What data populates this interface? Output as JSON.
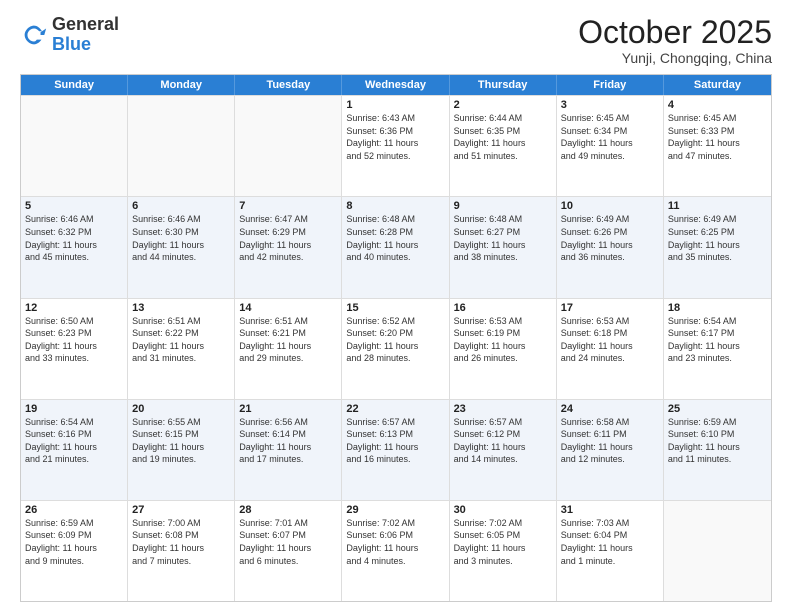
{
  "header": {
    "logo_general": "General",
    "logo_blue": "Blue",
    "month": "October 2025",
    "location": "Yunji, Chongqing, China"
  },
  "weekdays": [
    "Sunday",
    "Monday",
    "Tuesday",
    "Wednesday",
    "Thursday",
    "Friday",
    "Saturday"
  ],
  "rows": [
    [
      {
        "day": "",
        "text": ""
      },
      {
        "day": "",
        "text": ""
      },
      {
        "day": "",
        "text": ""
      },
      {
        "day": "1",
        "text": "Sunrise: 6:43 AM\nSunset: 6:36 PM\nDaylight: 11 hours\nand 52 minutes."
      },
      {
        "day": "2",
        "text": "Sunrise: 6:44 AM\nSunset: 6:35 PM\nDaylight: 11 hours\nand 51 minutes."
      },
      {
        "day": "3",
        "text": "Sunrise: 6:45 AM\nSunset: 6:34 PM\nDaylight: 11 hours\nand 49 minutes."
      },
      {
        "day": "4",
        "text": "Sunrise: 6:45 AM\nSunset: 6:33 PM\nDaylight: 11 hours\nand 47 minutes."
      }
    ],
    [
      {
        "day": "5",
        "text": "Sunrise: 6:46 AM\nSunset: 6:32 PM\nDaylight: 11 hours\nand 45 minutes."
      },
      {
        "day": "6",
        "text": "Sunrise: 6:46 AM\nSunset: 6:30 PM\nDaylight: 11 hours\nand 44 minutes."
      },
      {
        "day": "7",
        "text": "Sunrise: 6:47 AM\nSunset: 6:29 PM\nDaylight: 11 hours\nand 42 minutes."
      },
      {
        "day": "8",
        "text": "Sunrise: 6:48 AM\nSunset: 6:28 PM\nDaylight: 11 hours\nand 40 minutes."
      },
      {
        "day": "9",
        "text": "Sunrise: 6:48 AM\nSunset: 6:27 PM\nDaylight: 11 hours\nand 38 minutes."
      },
      {
        "day": "10",
        "text": "Sunrise: 6:49 AM\nSunset: 6:26 PM\nDaylight: 11 hours\nand 36 minutes."
      },
      {
        "day": "11",
        "text": "Sunrise: 6:49 AM\nSunset: 6:25 PM\nDaylight: 11 hours\nand 35 minutes."
      }
    ],
    [
      {
        "day": "12",
        "text": "Sunrise: 6:50 AM\nSunset: 6:23 PM\nDaylight: 11 hours\nand 33 minutes."
      },
      {
        "day": "13",
        "text": "Sunrise: 6:51 AM\nSunset: 6:22 PM\nDaylight: 11 hours\nand 31 minutes."
      },
      {
        "day": "14",
        "text": "Sunrise: 6:51 AM\nSunset: 6:21 PM\nDaylight: 11 hours\nand 29 minutes."
      },
      {
        "day": "15",
        "text": "Sunrise: 6:52 AM\nSunset: 6:20 PM\nDaylight: 11 hours\nand 28 minutes."
      },
      {
        "day": "16",
        "text": "Sunrise: 6:53 AM\nSunset: 6:19 PM\nDaylight: 11 hours\nand 26 minutes."
      },
      {
        "day": "17",
        "text": "Sunrise: 6:53 AM\nSunset: 6:18 PM\nDaylight: 11 hours\nand 24 minutes."
      },
      {
        "day": "18",
        "text": "Sunrise: 6:54 AM\nSunset: 6:17 PM\nDaylight: 11 hours\nand 23 minutes."
      }
    ],
    [
      {
        "day": "19",
        "text": "Sunrise: 6:54 AM\nSunset: 6:16 PM\nDaylight: 11 hours\nand 21 minutes."
      },
      {
        "day": "20",
        "text": "Sunrise: 6:55 AM\nSunset: 6:15 PM\nDaylight: 11 hours\nand 19 minutes."
      },
      {
        "day": "21",
        "text": "Sunrise: 6:56 AM\nSunset: 6:14 PM\nDaylight: 11 hours\nand 17 minutes."
      },
      {
        "day": "22",
        "text": "Sunrise: 6:57 AM\nSunset: 6:13 PM\nDaylight: 11 hours\nand 16 minutes."
      },
      {
        "day": "23",
        "text": "Sunrise: 6:57 AM\nSunset: 6:12 PM\nDaylight: 11 hours\nand 14 minutes."
      },
      {
        "day": "24",
        "text": "Sunrise: 6:58 AM\nSunset: 6:11 PM\nDaylight: 11 hours\nand 12 minutes."
      },
      {
        "day": "25",
        "text": "Sunrise: 6:59 AM\nSunset: 6:10 PM\nDaylight: 11 hours\nand 11 minutes."
      }
    ],
    [
      {
        "day": "26",
        "text": "Sunrise: 6:59 AM\nSunset: 6:09 PM\nDaylight: 11 hours\nand 9 minutes."
      },
      {
        "day": "27",
        "text": "Sunrise: 7:00 AM\nSunset: 6:08 PM\nDaylight: 11 hours\nand 7 minutes."
      },
      {
        "day": "28",
        "text": "Sunrise: 7:01 AM\nSunset: 6:07 PM\nDaylight: 11 hours\nand 6 minutes."
      },
      {
        "day": "29",
        "text": "Sunrise: 7:02 AM\nSunset: 6:06 PM\nDaylight: 11 hours\nand 4 minutes."
      },
      {
        "day": "30",
        "text": "Sunrise: 7:02 AM\nSunset: 6:05 PM\nDaylight: 11 hours\nand 3 minutes."
      },
      {
        "day": "31",
        "text": "Sunrise: 7:03 AM\nSunset: 6:04 PM\nDaylight: 11 hours\nand 1 minute."
      },
      {
        "day": "",
        "text": ""
      }
    ]
  ]
}
